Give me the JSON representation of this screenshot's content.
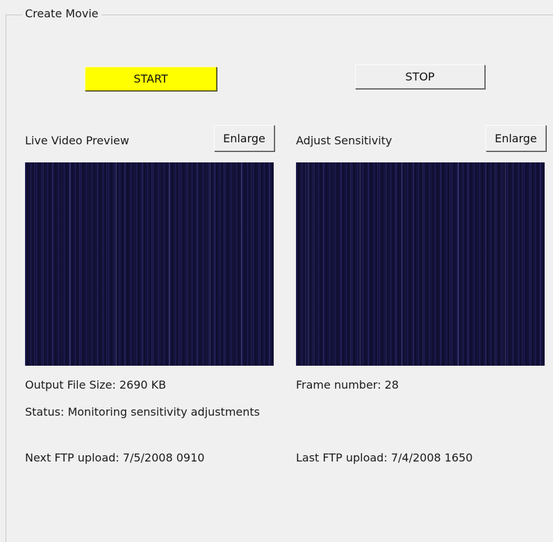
{
  "group": {
    "title": "Create Movie"
  },
  "buttons": {
    "start": "START",
    "stop": "STOP",
    "enlarge": "Enlarge"
  },
  "live_preview": {
    "label": "Live Video Preview"
  },
  "sensitivity": {
    "label": "Adjust Sensitivity"
  },
  "info": {
    "output_file_size": "Output File Size:  2690 KB",
    "frame_number": "Frame number:  28",
    "status": "Status:  Monitoring sensitivity adjustments",
    "next_ftp": "Next FTP upload:  7/5/2008 0910",
    "last_ftp": "Last FTP upload:  7/4/2008 1650"
  },
  "colors": {
    "start_button": "#ffff00",
    "preview_background": "#14123a"
  }
}
